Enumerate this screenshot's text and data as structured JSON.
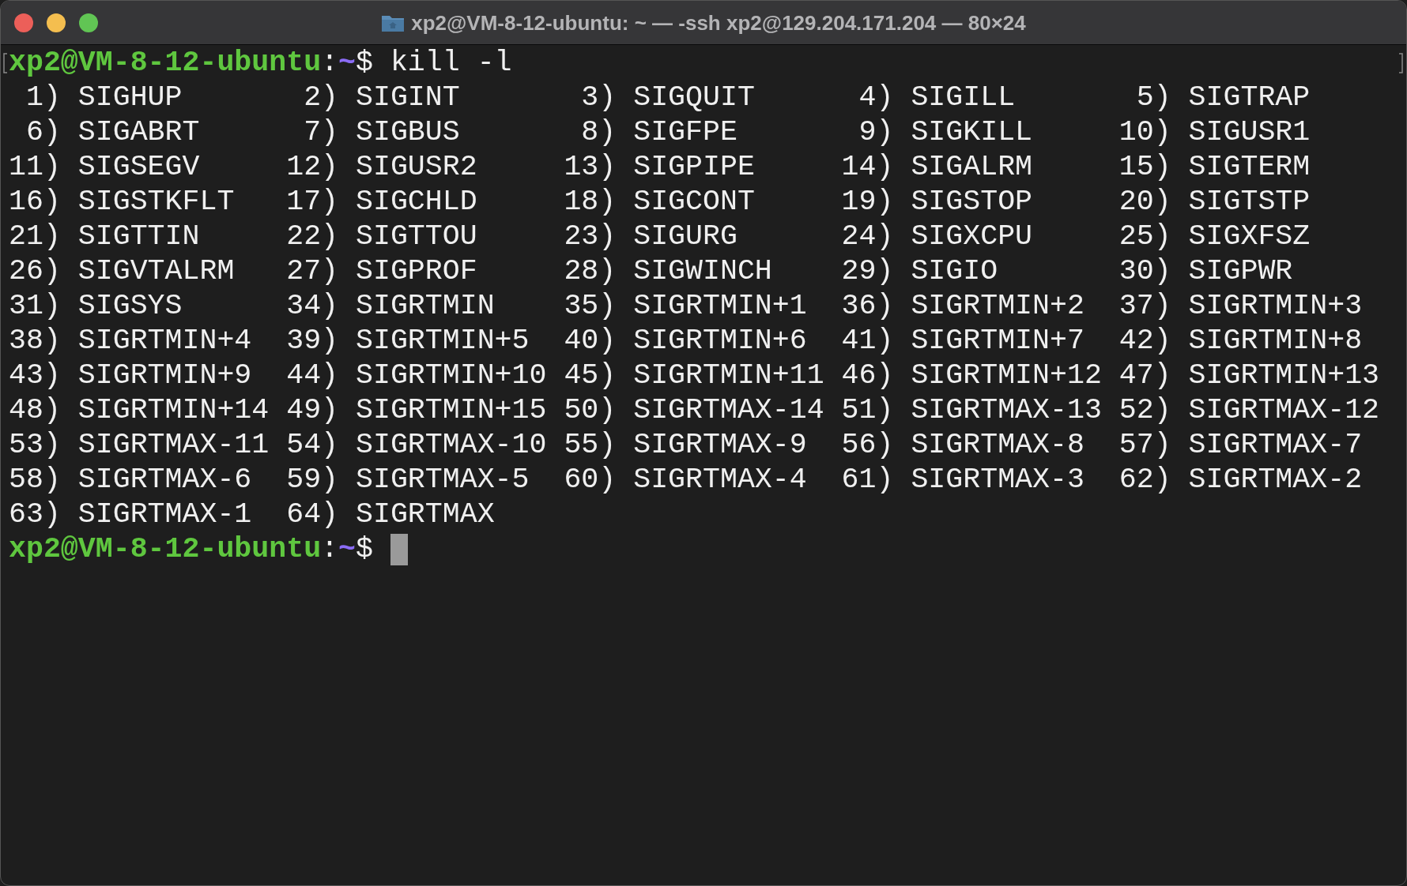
{
  "window": {
    "title": "xp2@VM-8-12-ubuntu: ~ — -ssh xp2@129.204.171.204 — 80×24"
  },
  "terminal": {
    "command_prompt": {
      "user_host": "xp2@VM-8-12-ubuntu",
      "separator": ":",
      "path": "~",
      "symbol": "$",
      "command": "kill -l"
    },
    "signals": [
      {
        "number": "1)",
        "name": "SIGHUP"
      },
      {
        "number": "2)",
        "name": "SIGINT"
      },
      {
        "number": "3)",
        "name": "SIGQUIT"
      },
      {
        "number": "4)",
        "name": "SIGILL"
      },
      {
        "number": "5)",
        "name": "SIGTRAP"
      },
      {
        "number": "6)",
        "name": "SIGABRT"
      },
      {
        "number": "7)",
        "name": "SIGBUS"
      },
      {
        "number": "8)",
        "name": "SIGFPE"
      },
      {
        "number": "9)",
        "name": "SIGKILL"
      },
      {
        "number": "10)",
        "name": "SIGUSR1"
      },
      {
        "number": "11)",
        "name": "SIGSEGV"
      },
      {
        "number": "12)",
        "name": "SIGUSR2"
      },
      {
        "number": "13)",
        "name": "SIGPIPE"
      },
      {
        "number": "14)",
        "name": "SIGALRM"
      },
      {
        "number": "15)",
        "name": "SIGTERM"
      },
      {
        "number": "16)",
        "name": "SIGSTKFLT"
      },
      {
        "number": "17)",
        "name": "SIGCHLD"
      },
      {
        "number": "18)",
        "name": "SIGCONT"
      },
      {
        "number": "19)",
        "name": "SIGSTOP"
      },
      {
        "number": "20)",
        "name": "SIGTSTP"
      },
      {
        "number": "21)",
        "name": "SIGTTIN"
      },
      {
        "number": "22)",
        "name": "SIGTTOU"
      },
      {
        "number": "23)",
        "name": "SIGURG"
      },
      {
        "number": "24)",
        "name": "SIGXCPU"
      },
      {
        "number": "25)",
        "name": "SIGXFSZ"
      },
      {
        "number": "26)",
        "name": "SIGVTALRM"
      },
      {
        "number": "27)",
        "name": "SIGPROF"
      },
      {
        "number": "28)",
        "name": "SIGWINCH"
      },
      {
        "number": "29)",
        "name": "SIGIO"
      },
      {
        "number": "30)",
        "name": "SIGPWR"
      },
      {
        "number": "31)",
        "name": "SIGSYS"
      },
      {
        "number": "34)",
        "name": "SIGRTMIN"
      },
      {
        "number": "35)",
        "name": "SIGRTMIN+1"
      },
      {
        "number": "36)",
        "name": "SIGRTMIN+2"
      },
      {
        "number": "37)",
        "name": "SIGRTMIN+3"
      },
      {
        "number": "38)",
        "name": "SIGRTMIN+4"
      },
      {
        "number": "39)",
        "name": "SIGRTMIN+5"
      },
      {
        "number": "40)",
        "name": "SIGRTMIN+6"
      },
      {
        "number": "41)",
        "name": "SIGRTMIN+7"
      },
      {
        "number": "42)",
        "name": "SIGRTMIN+8"
      },
      {
        "number": "43)",
        "name": "SIGRTMIN+9"
      },
      {
        "number": "44)",
        "name": "SIGRTMIN+10"
      },
      {
        "number": "45)",
        "name": "SIGRTMIN+11"
      },
      {
        "number": "46)",
        "name": "SIGRTMIN+12"
      },
      {
        "number": "47)",
        "name": "SIGRTMIN+13"
      },
      {
        "number": "48)",
        "name": "SIGRTMIN+14"
      },
      {
        "number": "49)",
        "name": "SIGRTMIN+15"
      },
      {
        "number": "50)",
        "name": "SIGRTMAX-14"
      },
      {
        "number": "51)",
        "name": "SIGRTMAX-13"
      },
      {
        "number": "52)",
        "name": "SIGRTMAX-12"
      },
      {
        "number": "53)",
        "name": "SIGRTMAX-11"
      },
      {
        "number": "54)",
        "name": "SIGRTMAX-10"
      },
      {
        "number": "55)",
        "name": "SIGRTMAX-9"
      },
      {
        "number": "56)",
        "name": "SIGRTMAX-8"
      },
      {
        "number": "57)",
        "name": "SIGRTMAX-7"
      },
      {
        "number": "58)",
        "name": "SIGRTMAX-6"
      },
      {
        "number": "59)",
        "name": "SIGRTMAX-5"
      },
      {
        "number": "60)",
        "name": "SIGRTMAX-4"
      },
      {
        "number": "61)",
        "name": "SIGRTMAX-3"
      },
      {
        "number": "62)",
        "name": "SIGRTMAX-2"
      },
      {
        "number": "63)",
        "name": "SIGRTMAX-1"
      },
      {
        "number": "64)",
        "name": "SIGRTMAX"
      }
    ],
    "current_prompt": {
      "user_host": "xp2@VM-8-12-ubuntu",
      "separator": ":",
      "path": "~",
      "symbol": "$"
    }
  }
}
